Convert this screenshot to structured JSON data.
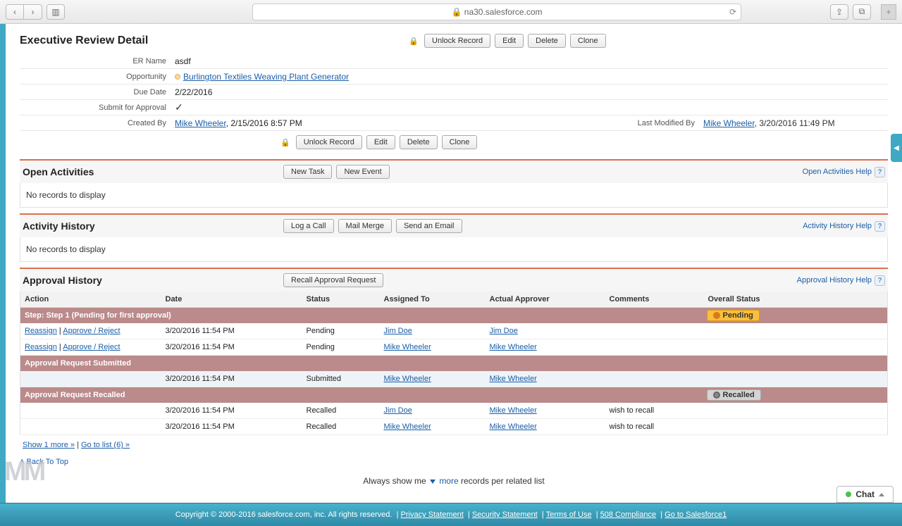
{
  "browser": {
    "url": "na30.salesforce.com",
    "lock": "🔒"
  },
  "detail": {
    "title": "Executive Review Detail",
    "unlock": "Unlock Record",
    "edit": "Edit",
    "delete": "Delete",
    "clone": "Clone",
    "fields": {
      "er_name_label": "ER Name",
      "er_name": "asdf",
      "opportunity_label": "Opportunity",
      "opportunity": "Burlington Textiles Weaving Plant Generator",
      "due_date_label": "Due Date",
      "due_date": "2/22/2016",
      "submit_label": "Submit for Approval",
      "created_by_label": "Created By",
      "created_by_name": "Mike Wheeler",
      "created_by_date": ", 2/15/2016 8:57 PM",
      "last_mod_label": "Last Modified By",
      "last_mod_name": "Mike Wheeler",
      "last_mod_date": ", 3/20/2016 11:49 PM"
    }
  },
  "open_activities": {
    "title": "Open Activities",
    "new_task": "New Task",
    "new_event": "New Event",
    "help": "Open Activities Help",
    "empty": "No records to display"
  },
  "activity_history": {
    "title": "Activity History",
    "log_call": "Log a Call",
    "mail_merge": "Mail Merge",
    "send_email": "Send an Email",
    "help": "Activity History Help",
    "empty": "No records to display"
  },
  "approval": {
    "title": "Approval History",
    "recall": "Recall Approval Request",
    "help": "Approval History Help",
    "cols": {
      "action": "Action",
      "date": "Date",
      "status": "Status",
      "assigned": "Assigned To",
      "approver": "Actual Approver",
      "comments": "Comments",
      "overall": "Overall Status"
    },
    "group1": "Step: Step 1 (Pending for first approval)",
    "pending_badge": "Pending",
    "group2": "Approval Request Submitted",
    "group3": "Approval Request Recalled",
    "recalled_badge": "Recalled",
    "action_reassign": "Reassign",
    "action_divider": " | ",
    "action_approve": "Approve / Reject",
    "rows_pending": [
      {
        "date": "3/20/2016 11:54 PM",
        "status": "Pending",
        "assigned": "Jim Doe",
        "approver": "Jim Doe",
        "comments": ""
      },
      {
        "date": "3/20/2016 11:54 PM",
        "status": "Pending",
        "assigned": "Mike Wheeler",
        "approver": "Mike Wheeler",
        "comments": ""
      }
    ],
    "row_submitted": {
      "date": "3/20/2016 11:54 PM",
      "status": "Submitted",
      "assigned": "Mike Wheeler",
      "approver": "Mike Wheeler",
      "comments": ""
    },
    "rows_recalled": [
      {
        "date": "3/20/2016 11:54 PM",
        "status": "Recalled",
        "assigned": "Jim Doe",
        "approver": "Mike Wheeler",
        "comments": "wish to recall"
      },
      {
        "date": "3/20/2016 11:54 PM",
        "status": "Recalled",
        "assigned": "Mike Wheeler",
        "approver": "Mike Wheeler",
        "comments": "wish to recall"
      }
    ],
    "show_more": "Show 1 more »",
    "go_list": "Go to list (6) »"
  },
  "back_top": "Back To Top",
  "related_hint": {
    "pre": "Always show me ",
    "more": "more",
    "post": " records per related list"
  },
  "footer": {
    "copyright": "Copyright © 2000-2016 salesforce.com, inc. All rights reserved.",
    "links": [
      "Privacy Statement",
      "Security Statement",
      "Terms of Use",
      "508 Compliance",
      "Go to Salesforce1"
    ]
  },
  "chat": "Chat"
}
